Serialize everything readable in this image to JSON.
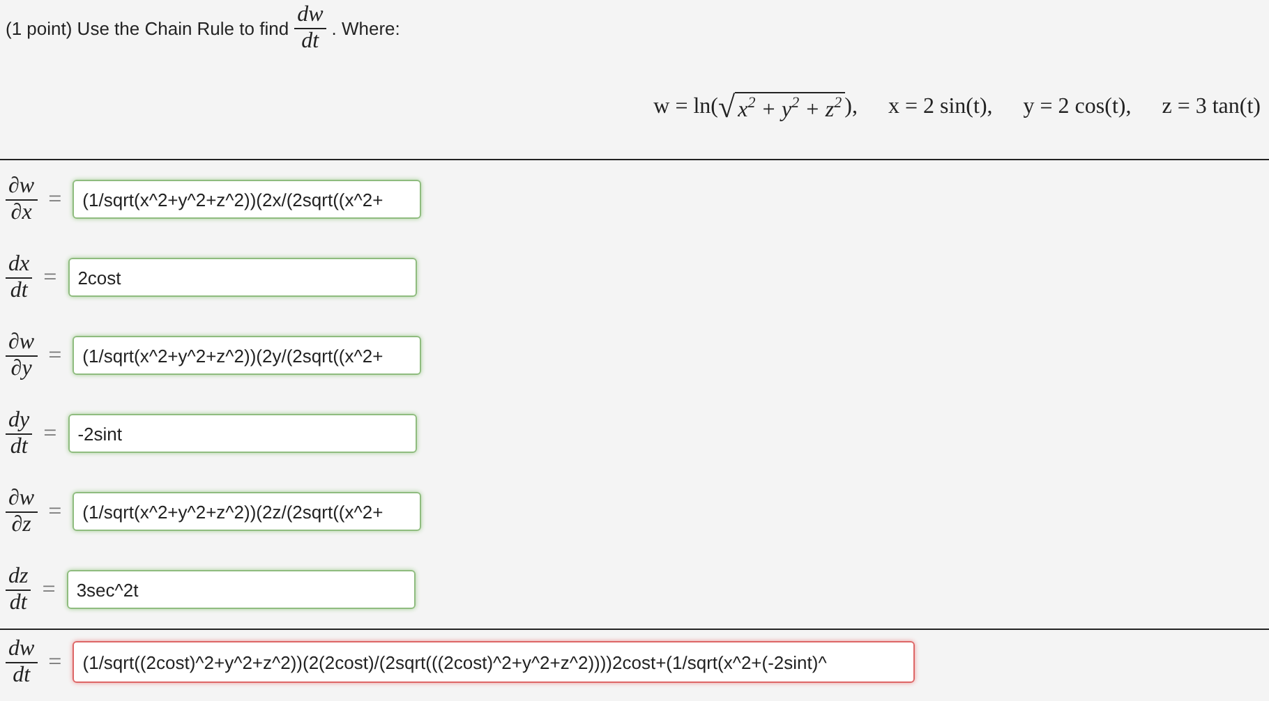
{
  "prompt": {
    "before": "(1 point) Use the Chain Rule to find",
    "numerator": "dw",
    "denominator": "dt",
    "after": ". Where:"
  },
  "equations": [
    {
      "kind": "radical",
      "before": "w = ln(",
      "root": "√",
      "radicand": "x$^{2}$ + y$^{2}$ + z$^{2}$",
      "after": "),"
    },
    {
      "kind": "plain",
      "text": "x = 2 sin(t),"
    },
    {
      "kind": "plain",
      "text": "y = 2 cos(t),"
    },
    {
      "kind": "plain",
      "text": "z = 3 tan(t)"
    }
  ],
  "rows": [
    {
      "numerator": "∂w",
      "denominator": "∂x",
      "relation": "=",
      "value": "(1/sqrt(x^2+y^2+z^2))(2x/(2sqrt((x^2+",
      "correct": true
    },
    {
      "numerator": "dx",
      "denominator": "dt",
      "relation": "=",
      "value": "2cost",
      "correct": true
    },
    {
      "numerator": "∂w",
      "denominator": "∂y",
      "relation": "=",
      "value": "(1/sqrt(x^2+y^2+z^2))(2y/(2sqrt((x^2+",
      "correct": true
    },
    {
      "numerator": "dy",
      "denominator": "dt",
      "relation": "=",
      "value": "-2sint",
      "correct": true
    },
    {
      "numerator": "∂w",
      "denominator": "∂z",
      "relation": "=",
      "value": "(1/sqrt(x^2+y^2+z^2))(2z/(2sqrt((x^2+",
      "correct": true
    },
    {
      "numerator": "dz",
      "denominator": "dt",
      "relation": "=",
      "value": "3sec^2t",
      "correct": true
    }
  ],
  "answer": {
    "numerator": "dw",
    "denominator": "dt",
    "relation": "=",
    "value": "(1/sqrt((2cost)^2+y^2+z^2))(2(2cost)/(2sqrt(((2cost)^2+y^2+z^2))))2cost+(1/sqrt(x^2+(-2sint)^",
    "correct": false
  }
}
